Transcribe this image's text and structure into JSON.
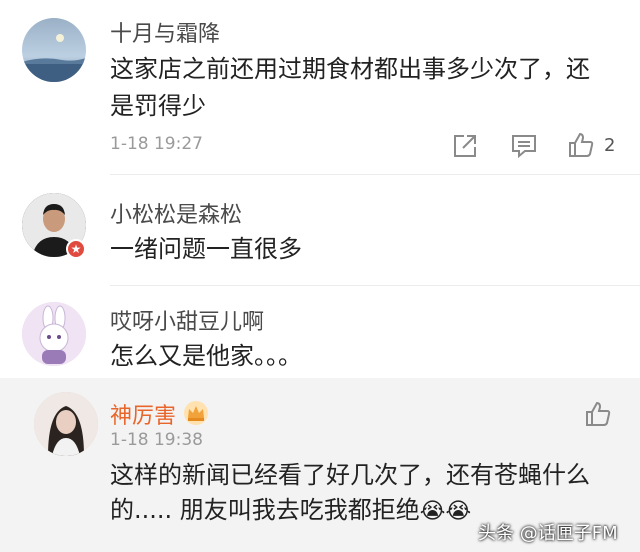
{
  "comments": [
    {
      "username": "十月与霜降",
      "text_line1": "这家店之前还用过期食材都出事多少次了，还",
      "text_line2": "是罚得少",
      "time": "1-18 19:27",
      "like_count": "2",
      "icons": [
        "share-icon",
        "comment-icon",
        "like-icon"
      ]
    },
    {
      "username": "小松松是森松",
      "text": "一绪问题一直很多"
    },
    {
      "username": "哎呀小甜豆儿啊",
      "text": "怎么又是他家。。。"
    },
    {
      "username": "神厉害",
      "time": "1-18 19:38",
      "text_line1": "这样的新闻已经看了好几次了，还有苍蝇什么",
      "text_line2": "的..... 朋友叫我去吃我都拒绝",
      "emoji": "😭😭"
    }
  ],
  "watermark": "头条 @话匣子FM",
  "colors": {
    "username_highlight": "#e8662c",
    "meta": "#9a9a9a",
    "badge_red": "#e04a3f"
  }
}
